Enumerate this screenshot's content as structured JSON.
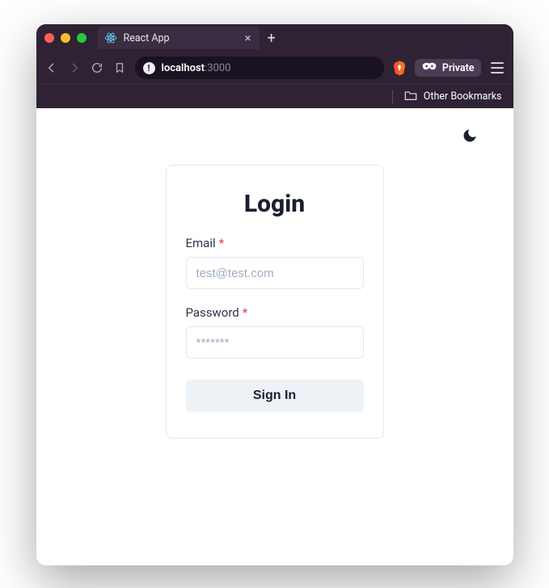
{
  "browser": {
    "tab_title": "React App",
    "url_host": "localhost",
    "url_port": ":3000",
    "private_label": "Private",
    "other_bookmarks_label": "Other Bookmarks"
  },
  "page": {
    "title": "Login",
    "email": {
      "label": "Email",
      "required_mark": "*",
      "placeholder": "test@test.com"
    },
    "password": {
      "label": "Password",
      "required_mark": "*",
      "placeholder": "*******"
    },
    "signin_label": "Sign In"
  }
}
